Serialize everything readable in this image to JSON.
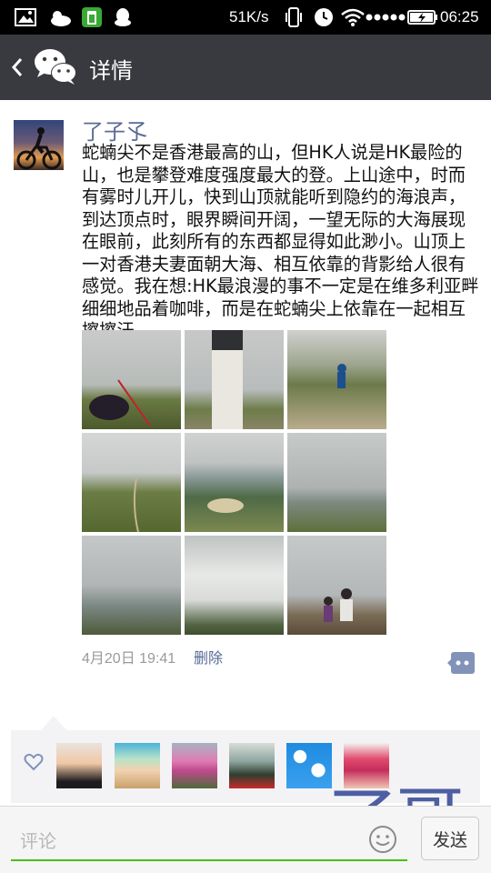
{
  "status_bar": {
    "network_speed": "51K/s",
    "time": "06:25",
    "icons": [
      "gallery-icon",
      "weather-icon",
      "battery-saver-icon",
      "qq-icon",
      "vibrate-icon",
      "alarm-icon",
      "wifi-icon",
      "signal-dots-icon",
      "battery-icon"
    ]
  },
  "title_bar": {
    "title": "详情",
    "icons": [
      "back-arrow-icon",
      "wechat-logo-icon"
    ]
  },
  "post": {
    "username": "了子孓",
    "text": "蛇蝻尖不是香港最高的山，但HK人说是HK最险的山，也是攀登难度强度最大的登。上山途中，时而有雾时儿开儿，快到山顶就能听到隐约的海浪声，到达顶点时，眼界瞬间开阔，一望无际的大海展现在眼前，此刻所有的东西都显得如此渺小。山顶上一对香港夫妻面朝大海、相互依靠的背影给人很有感觉。我在想:HK最浪漫的事不一定是在维多利亚畔细细地品着咖啡，而是在蛇蝻尖上依靠在一起相互擦擦汗",
    "photo_count": 9,
    "time": "4月20日 19:41",
    "delete_label": "删除"
  },
  "likes": {
    "count": 6,
    "icon": "heart-icon"
  },
  "watermark": "了哥",
  "input_bar": {
    "placeholder": "评论",
    "send_label": "发送",
    "accent_color": "#45c01a"
  },
  "colors": {
    "title_bar": "#393a3f",
    "link": "#576b95",
    "likes_bg": "#f3f3f5"
  }
}
